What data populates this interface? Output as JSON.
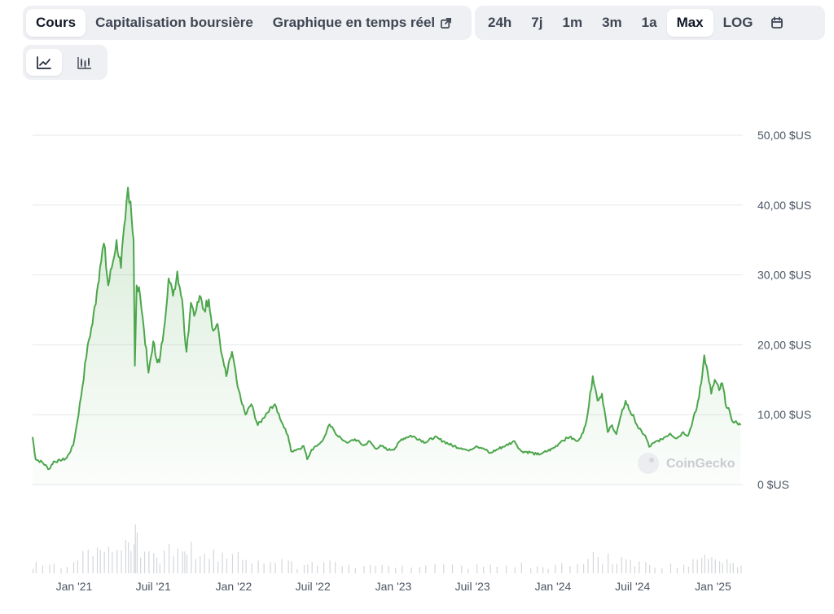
{
  "range_tabs": {
    "items": [
      {
        "label": "Cours",
        "active": true
      },
      {
        "label": "Capitalisation boursière",
        "active": false
      },
      {
        "label": "Graphique en temps réel",
        "active": false
      }
    ]
  },
  "period_tabs": {
    "items": [
      {
        "label": "24h",
        "active": false
      },
      {
        "label": "7j",
        "active": false
      },
      {
        "label": "1m",
        "active": false
      },
      {
        "label": "3m",
        "active": false
      },
      {
        "label": "1a",
        "active": false
      },
      {
        "label": "Max",
        "active": true
      },
      {
        "label": "LOG",
        "active": false
      }
    ]
  },
  "view_toggle": {
    "selected": "line"
  },
  "watermark": "CoinGecko",
  "colors": {
    "line": "#4ca64c",
    "area_top": "#4ca64c",
    "grid": "#e5e7eb",
    "volume": "#d4d7dc"
  },
  "chart_data": {
    "type": "area",
    "title": "",
    "xlabel": "",
    "ylabel": "",
    "ylim": [
      0,
      50
    ],
    "xlim": [
      "2020-09-28",
      "2025-03-10"
    ],
    "grid": true,
    "y_ticks": [
      {
        "value": 0,
        "label": "0 $US"
      },
      {
        "value": 10,
        "label": "10,00 $US"
      },
      {
        "value": 20,
        "label": "20,00 $US"
      },
      {
        "value": 30,
        "label": "30,00 $US"
      },
      {
        "value": 40,
        "label": "40,00 $US"
      },
      {
        "value": 50,
        "label": "50,00 $US"
      }
    ],
    "x_ticks": [
      {
        "date": "2021-01-01",
        "label": "Jan '21"
      },
      {
        "date": "2021-07-01",
        "label": "Juil '21"
      },
      {
        "date": "2022-01-01",
        "label": "Jan '22"
      },
      {
        "date": "2022-07-01",
        "label": "Juil '22"
      },
      {
        "date": "2023-01-01",
        "label": "Jan '23"
      },
      {
        "date": "2023-07-01",
        "label": "Juil '23"
      },
      {
        "date": "2024-01-01",
        "label": "Jan '24"
      },
      {
        "date": "2024-07-01",
        "label": "Juil '24"
      },
      {
        "date": "2025-01-01",
        "label": "Jan '25"
      }
    ],
    "series": [
      {
        "values": [
          [
            "2020-09-28",
            6.8
          ],
          [
            "2020-10-05",
            3.6
          ],
          [
            "2020-10-20",
            3.2
          ],
          [
            "2020-11-05",
            2.2
          ],
          [
            "2020-11-15",
            3.3
          ],
          [
            "2020-12-01",
            3.4
          ],
          [
            "2020-12-15",
            3.8
          ],
          [
            "2020-12-30",
            5.6
          ],
          [
            "2021-01-08",
            8.9
          ],
          [
            "2021-01-20",
            14.0
          ],
          [
            "2021-02-01",
            20.0
          ],
          [
            "2021-02-12",
            23.0
          ],
          [
            "2021-02-22",
            27.5
          ],
          [
            "2021-03-01",
            31.0
          ],
          [
            "2021-03-10",
            34.5
          ],
          [
            "2021-03-20",
            28.5
          ],
          [
            "2021-03-28",
            31.0
          ],
          [
            "2021-04-08",
            35.0
          ],
          [
            "2021-04-18",
            31.0
          ],
          [
            "2021-04-28",
            38.0
          ],
          [
            "2021-05-04",
            42.5
          ],
          [
            "2021-05-10",
            40.5
          ],
          [
            "2021-05-17",
            35.0
          ],
          [
            "2021-05-20",
            17.0
          ],
          [
            "2021-05-24",
            28.5
          ],
          [
            "2021-06-01",
            27.0
          ],
          [
            "2021-06-10",
            22.0
          ],
          [
            "2021-06-20",
            16.0
          ],
          [
            "2021-07-01",
            20.5
          ],
          [
            "2021-07-08",
            18.0
          ],
          [
            "2021-07-15",
            17.5
          ],
          [
            "2021-07-25",
            22.0
          ],
          [
            "2021-08-05",
            29.5
          ],
          [
            "2021-08-15",
            27.0
          ],
          [
            "2021-08-25",
            30.5
          ],
          [
            "2021-09-05",
            26.5
          ],
          [
            "2021-09-10",
            22.0
          ],
          [
            "2021-09-15",
            19.0
          ],
          [
            "2021-09-25",
            26.0
          ],
          [
            "2021-10-05",
            24.5
          ],
          [
            "2021-10-15",
            27.0
          ],
          [
            "2021-10-25",
            25.0
          ],
          [
            "2021-11-05",
            26.5
          ],
          [
            "2021-11-15",
            22.0
          ],
          [
            "2021-11-25",
            23.0
          ],
          [
            "2021-12-05",
            18.5
          ],
          [
            "2021-12-15",
            15.5
          ],
          [
            "2021-12-28",
            19.0
          ],
          [
            "2022-01-10",
            14.0
          ],
          [
            "2022-01-20",
            11.5
          ],
          [
            "2022-01-28",
            10.0
          ],
          [
            "2022-02-10",
            11.5
          ],
          [
            "2022-02-25",
            8.5
          ],
          [
            "2022-03-10",
            9.5
          ],
          [
            "2022-03-25",
            11.0
          ],
          [
            "2022-04-05",
            11.5
          ],
          [
            "2022-04-20",
            9.0
          ],
          [
            "2022-05-05",
            7.0
          ],
          [
            "2022-05-12",
            4.8
          ],
          [
            "2022-05-25",
            5.0
          ],
          [
            "2022-06-10",
            5.5
          ],
          [
            "2022-06-18",
            3.6
          ],
          [
            "2022-06-28",
            5.0
          ],
          [
            "2022-07-10",
            5.5
          ],
          [
            "2022-07-25",
            6.5
          ],
          [
            "2022-08-08",
            8.6
          ],
          [
            "2022-08-20",
            7.5
          ],
          [
            "2022-09-05",
            6.5
          ],
          [
            "2022-09-20",
            6.0
          ],
          [
            "2022-10-05",
            6.5
          ],
          [
            "2022-10-25",
            5.6
          ],
          [
            "2022-11-08",
            6.2
          ],
          [
            "2022-11-20",
            5.2
          ],
          [
            "2022-12-05",
            5.5
          ],
          [
            "2022-12-20",
            4.9
          ],
          [
            "2023-01-05",
            5.2
          ],
          [
            "2023-01-20",
            6.5
          ],
          [
            "2023-02-10",
            7.0
          ],
          [
            "2023-03-01",
            6.5
          ],
          [
            "2023-03-15",
            6.0
          ],
          [
            "2023-04-05",
            6.8
          ],
          [
            "2023-04-25",
            6.2
          ],
          [
            "2023-05-15",
            5.6
          ],
          [
            "2023-06-05",
            5.2
          ],
          [
            "2023-06-20",
            4.9
          ],
          [
            "2023-07-10",
            5.5
          ],
          [
            "2023-07-25",
            5.2
          ],
          [
            "2023-08-10",
            4.5
          ],
          [
            "2023-08-25",
            5.0
          ],
          [
            "2023-09-15",
            5.6
          ],
          [
            "2023-10-05",
            6.2
          ],
          [
            "2023-10-20",
            4.8
          ],
          [
            "2023-11-10",
            4.6
          ],
          [
            "2023-11-25",
            4.3
          ],
          [
            "2023-12-08",
            4.5
          ],
          [
            "2023-12-20",
            4.8
          ],
          [
            "2024-01-05",
            5.3
          ],
          [
            "2024-01-20",
            6.2
          ],
          [
            "2024-02-08",
            6.8
          ],
          [
            "2024-02-25",
            6.2
          ],
          [
            "2024-03-10",
            7.4
          ],
          [
            "2024-03-20",
            10.0
          ],
          [
            "2024-04-01",
            15.5
          ],
          [
            "2024-04-12",
            12.0
          ],
          [
            "2024-04-22",
            13.0
          ],
          [
            "2024-05-05",
            7.5
          ],
          [
            "2024-05-15",
            8.5
          ],
          [
            "2024-05-25",
            7.2
          ],
          [
            "2024-06-05",
            10.0
          ],
          [
            "2024-06-15",
            12.0
          ],
          [
            "2024-06-25",
            10.5
          ],
          [
            "2024-07-05",
            9.5
          ],
          [
            "2024-07-15",
            8.0
          ],
          [
            "2024-07-30",
            7.0
          ],
          [
            "2024-08-08",
            5.4
          ],
          [
            "2024-08-20",
            6.0
          ],
          [
            "2024-09-05",
            6.5
          ],
          [
            "2024-09-25",
            7.3
          ],
          [
            "2024-10-10",
            6.6
          ],
          [
            "2024-10-25",
            7.5
          ],
          [
            "2024-11-05",
            7.0
          ],
          [
            "2024-11-15",
            9.0
          ],
          [
            "2024-11-25",
            11.0
          ],
          [
            "2024-12-05",
            14.5
          ],
          [
            "2024-12-12",
            18.5
          ],
          [
            "2024-12-20",
            16.0
          ],
          [
            "2024-12-28",
            13.0
          ],
          [
            "2025-01-05",
            15.0
          ],
          [
            "2025-01-15",
            13.5
          ],
          [
            "2025-01-22",
            14.5
          ],
          [
            "2025-02-01",
            11.0
          ],
          [
            "2025-02-08",
            10.5
          ],
          [
            "2025-02-15",
            9.0
          ],
          [
            "2025-02-25",
            8.8
          ],
          [
            "2025-03-05",
            8.5
          ]
        ]
      }
    ]
  }
}
